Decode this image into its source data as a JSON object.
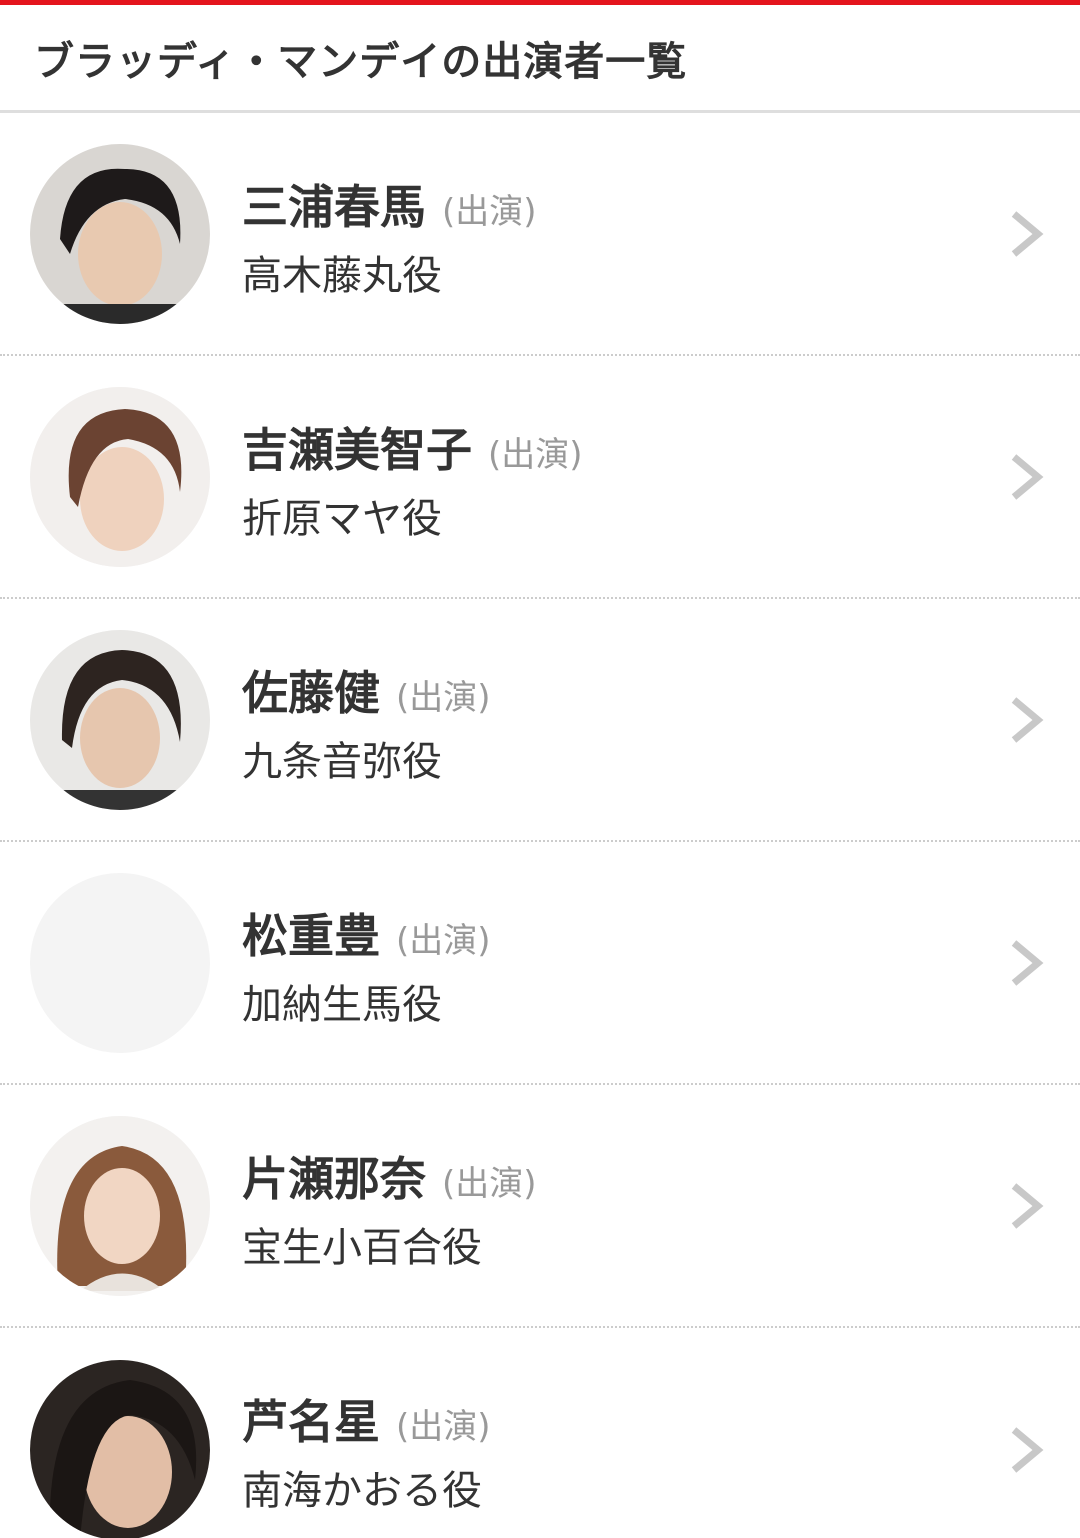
{
  "header": {
    "title": "ブラッディ・マンデイの出演者一覧"
  },
  "cast": [
    {
      "name": "三浦春馬",
      "credit": "(出演)",
      "role": "高木藤丸役",
      "avatar": "photo"
    },
    {
      "name": "吉瀬美智子",
      "credit": "(出演)",
      "role": "折原マヤ役",
      "avatar": "photo"
    },
    {
      "name": "佐藤健",
      "credit": "(出演)",
      "role": "九条音弥役",
      "avatar": "photo"
    },
    {
      "name": "松重豊",
      "credit": "(出演)",
      "role": "加納生馬役",
      "avatar": "placeholder"
    },
    {
      "name": "片瀬那奈",
      "credit": "(出演)",
      "role": "宝生小百合役",
      "avatar": "photo"
    },
    {
      "name": "芦名星",
      "credit": "(出演)",
      "role": "南海かおる役",
      "avatar": "photo"
    }
  ],
  "colors": {
    "accent": "#e4141d",
    "text": "#333333",
    "muted": "#999999",
    "chevron": "#c8c8c8",
    "placeholder": "#f4f4f4"
  },
  "icons": {
    "row_arrow": "chevron-right-icon"
  }
}
